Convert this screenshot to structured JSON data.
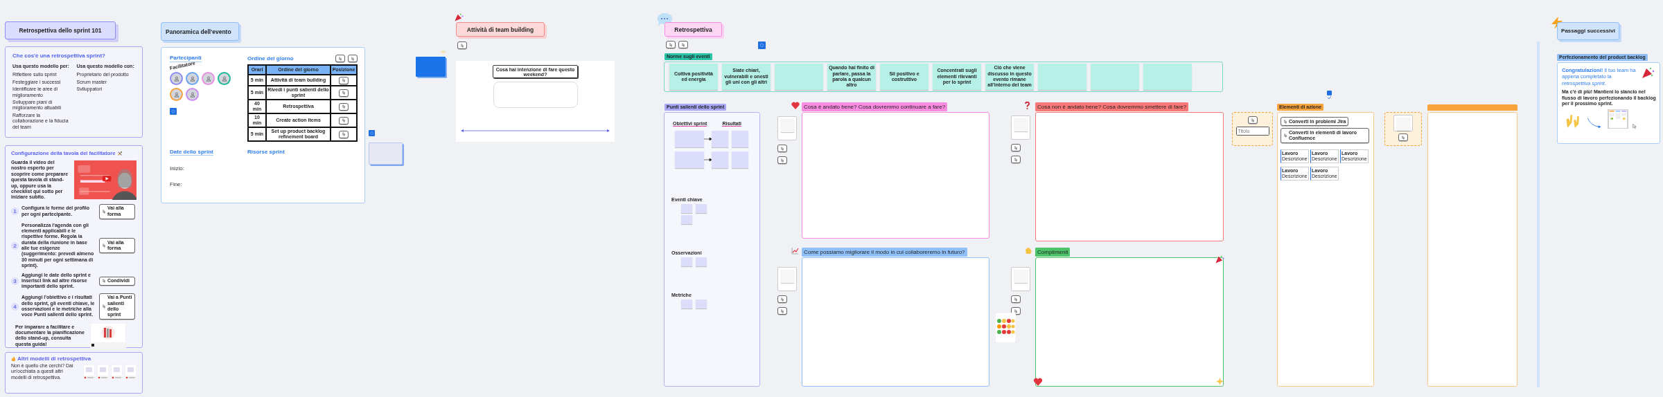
{
  "intro": {
    "title": "Retrospettiva dello sprint 101",
    "what": {
      "heading": "Che cos'è una retrospettiva sprint?",
      "uses_heading": "Usa questo modello per:",
      "uses": [
        "Riflettere sullo sprint",
        "Festeggiare i successi",
        "Identificare le aree di miglioramento",
        "Sviluppare piani di miglioramento attuabili",
        "Rafforzare la collaborazione e la fiducia del team"
      ],
      "users_heading": "Usa questo modello con:",
      "users": [
        "Proprietario del prodotto",
        "Scrum master",
        "Sviluppatori"
      ]
    },
    "setup": {
      "heading": "Configurazione della tavola del facilitatore",
      "intro": "Guarda il video del nostro esperto per scoprire come preparare questa tavola di stand-up, oppure usa la checklist qui sotto per iniziare subito.",
      "steps": [
        {
          "number": "1",
          "text": "Configura le forme del profilo per ogni partecipante.",
          "button": "Vai alla forma"
        },
        {
          "number": "2",
          "text": "Personalizza l'agenda con gli elementi applicabili e le rispettive forme. Regola la durata della riunione in base alle tue esigenze (suggerimento: prevedi almeno 30 minuti per ogni settimana di sprint).",
          "button": "Vai alla forma"
        },
        {
          "number": "3",
          "text": "Aggiungi le date dello sprint e inserisci link ad altre risorse importanti dello sprint.",
          "button": "Condividi"
        },
        {
          "number": "4",
          "text": "Aggiungi l'obiettivo e i risultati dello sprint, gli eventi chiave, le osservazioni e le metriche alla voce Punti salienti dello sprint.",
          "button": "Vai a Punti salienti dello sprint"
        }
      ],
      "guide_text": "Per imparare a facilitare e documentare la pianificazione dello stand-up, consulta questa guida!"
    },
    "more": {
      "heading": "Altri modelli di retrospettiva",
      "subtitle": "Non è quello che cerchi? Dai un'occhiata a questi altri modelli di retrospettiva."
    }
  },
  "overview": {
    "title": "Panoramica dell'evento",
    "participants": {
      "heading": "Partecipanti",
      "badge": "Facilitatore",
      "avatars": [
        {
          "color": "#8e8cf2"
        },
        {
          "color": "#6aa6f0"
        },
        {
          "color": "#ea8fe2"
        },
        {
          "color": "#1fb99a"
        },
        {
          "color": "#f5a13c"
        },
        {
          "color": "#c98cf0"
        }
      ]
    },
    "agenda": {
      "heading": "Ordine del giorno",
      "columns": [
        "Orari",
        "Ordine del giorno",
        "Posizione"
      ],
      "rows": [
        {
          "time": "5 min",
          "item": "Attività di team building"
        },
        {
          "time": "5 min",
          "item": "Rivedi i punti salienti dello sprint"
        },
        {
          "time": "40 min",
          "item": "Retrospettiva"
        },
        {
          "time": "10 min",
          "item": "Create action items"
        },
        {
          "time": "5 min",
          "item": "Set up product backlog refinement board"
        }
      ]
    },
    "dates": {
      "heading": "Date dello sprint",
      "fields": [
        "Inizio:",
        "Fine:"
      ]
    },
    "resources": {
      "heading": "Risorse sprint"
    }
  },
  "team_building": {
    "title": "Attività di team building",
    "question": "Cosa hai intenzione di fare questo weekend?"
  },
  "retro": {
    "title": "Retrospettiva",
    "norms": {
      "label": "Norme sugli eventi",
      "stickies": [
        {
          "kind": "text",
          "text": "Coltiva positività ed energia"
        },
        {
          "kind": "text",
          "text": "Siate chiari, vulnerabili e onesti gli uni con gli altri"
        },
        {
          "kind": "blank"
        },
        {
          "kind": "text",
          "text": "Quando hai finito di parlare, passa la parola a qualcun altro"
        },
        {
          "kind": "text",
          "text": "Sii positivo e costruttivo"
        },
        {
          "kind": "text",
          "text": "Concentrati sugli elementi rilevanti per lo sprint"
        },
        {
          "kind": "text",
          "text": "Ciò che viene discusso in questo evento rimane all'interno del team"
        },
        {
          "kind": "blank"
        },
        {
          "kind": "blank"
        },
        {
          "kind": "blank"
        }
      ]
    },
    "highlights": {
      "label": "Punti salienti dello sprint",
      "goals": "Obiettivi sprint",
      "results": "Risultati",
      "sections": [
        "Eventi chiave",
        "Osservazioni",
        "Metriche"
      ]
    },
    "boards": [
      {
        "title": "Cosa è andato bene? Cosa dovremmo continuare a fare?",
        "color": "#f78ce0"
      },
      {
        "title": "Cosa non è andato bene? Cosa dovremmo smettere di fare?",
        "color": "#f87878"
      },
      {
        "title": "Come possiamo migliorare il modo in cui collaboreremo in futuro?",
        "color": "#8fc0f7"
      },
      {
        "title": "Complimenti",
        "color": "#4ec46a"
      }
    ]
  },
  "actions": {
    "label": "Elementi di azione",
    "buttons": [
      "Converti in problemi Jira",
      "Converti in elementi di lavoro Confluence"
    ],
    "cards": [
      {
        "title": "Lavoro",
        "description": "Descrizione"
      },
      {
        "title": "Lavoro",
        "description": "Descrizione"
      },
      {
        "title": "Lavoro",
        "description": "Descrizione"
      },
      {
        "title": "Lavoro",
        "description": "Descrizione"
      },
      {
        "title": "Lavoro",
        "description": "Descrizione"
      }
    ],
    "staging": {
      "placeholder": "Titolo"
    }
  },
  "next_steps": {
    "title": "Passaggi successivi",
    "label": "Perfezionamento del product backlog",
    "headline": "**Congratulazioni!** Il tuo team ha appena completato la *retrospettiva sprint*.",
    "text": "Ma c'è di più! Mantieni lo slancio nel flusso di lavoro perfezionando il backlog per il prossimo sprint."
  }
}
